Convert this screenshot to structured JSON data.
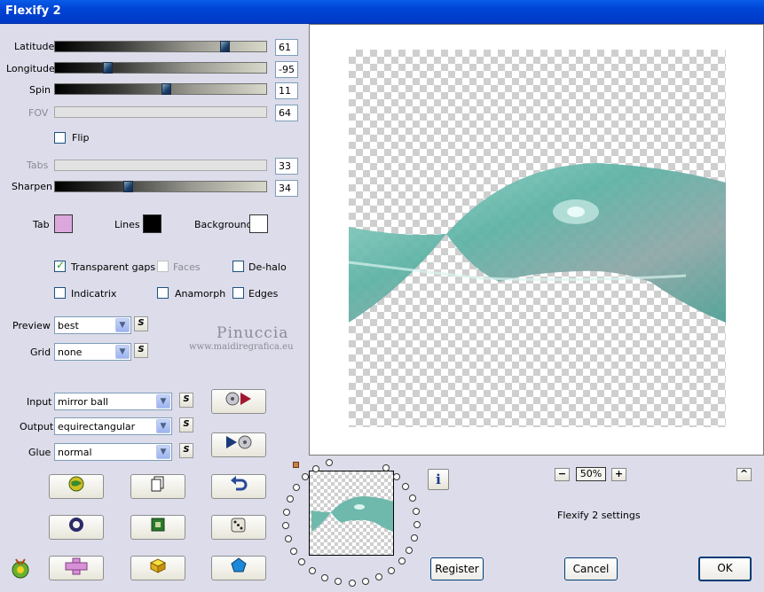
{
  "window": {
    "title": "Flexify 2"
  },
  "sliders": {
    "latitude": {
      "label": "Latitude",
      "value": "61",
      "fraction": 0.82
    },
    "longitude": {
      "label": "Longitude",
      "value": "-95",
      "fraction": 0.24
    },
    "spin": {
      "label": "Spin",
      "value": "11",
      "fraction": 0.53
    },
    "fov": {
      "label": "FOV",
      "value": "64"
    },
    "tabs": {
      "label": "Tabs",
      "value": "33"
    },
    "sharpen": {
      "label": "Sharpen",
      "value": "34",
      "fraction": 0.34
    }
  },
  "flip": {
    "label": "Flip",
    "checked": false
  },
  "colors": {
    "tab": {
      "label": "Tab",
      "color": "#dca8dc"
    },
    "lines": {
      "label": "Lines",
      "color": "#000000"
    },
    "background": {
      "label": "Background",
      "color": "#ffffff"
    }
  },
  "options": {
    "transparent_gaps": {
      "label": "Transparent gaps",
      "checked": true
    },
    "faces": {
      "label": "Faces",
      "checked": false
    },
    "de_halo": {
      "label": "De-halo",
      "checked": false
    },
    "indicatrix": {
      "label": "Indicatrix",
      "checked": false
    },
    "anamorph": {
      "label": "Anamorph",
      "checked": false
    },
    "edges": {
      "label": "Edges",
      "checked": false
    }
  },
  "preview_select": {
    "label": "Preview",
    "value": "best"
  },
  "grid_select": {
    "label": "Grid",
    "value": "none"
  },
  "input_select": {
    "label": "Input",
    "value": "mirror ball"
  },
  "output_select": {
    "label": "Output",
    "value": "equirectangular"
  },
  "glue_select": {
    "label": "Glue",
    "value": "normal"
  },
  "s_button": "S",
  "watermark": {
    "name": "Pinuccia",
    "url": "www.maidiregrafica.eu"
  },
  "zoom": {
    "minus": "−",
    "value": "50%",
    "plus": "+"
  },
  "settings_label": "Flexify 2 settings",
  "buttons": {
    "register": "Register",
    "cancel": "Cancel",
    "ok": "OK"
  },
  "info_icon": "i",
  "caret": "^"
}
